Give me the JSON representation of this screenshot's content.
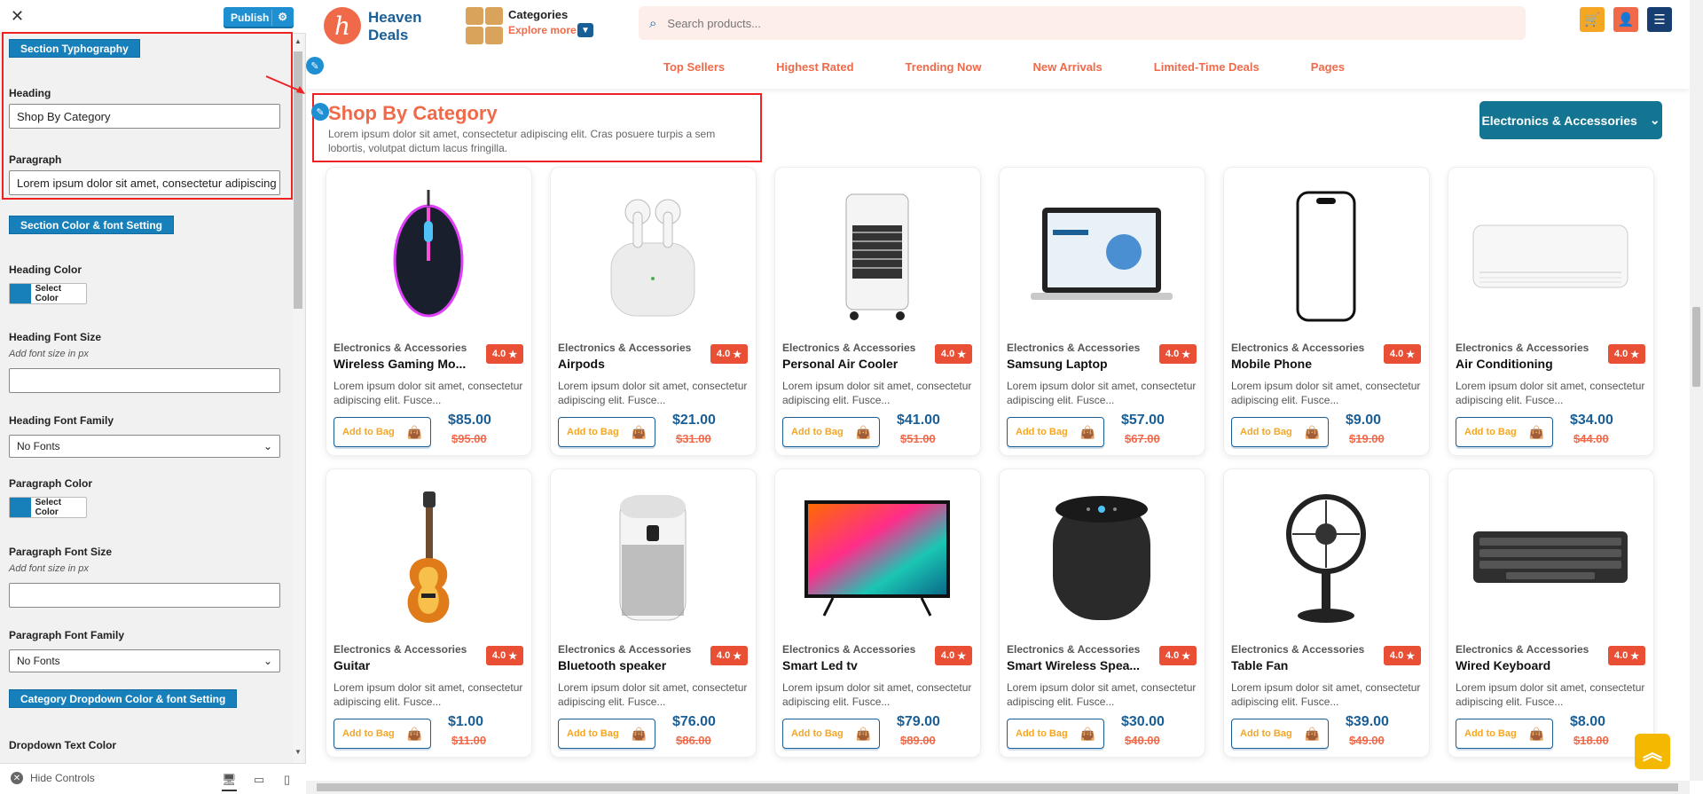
{
  "customizer": {
    "close": "✕",
    "publish": "Publish",
    "section_typography": "Section Typhography",
    "heading_label": "Heading",
    "heading_value": "Shop By Category",
    "paragraph_label": "Paragraph",
    "paragraph_value": "Lorem ipsum dolor sit amet, consectetur adipiscing elit. Cras posuere turpis a sem",
    "section_color_font": "Section Color & font Setting",
    "heading_color": "Heading Color",
    "select_color": "Select Color",
    "heading_font_size": "Heading Font Size",
    "add_font_size": "Add font size in px",
    "heading_font_family": "Heading Font Family",
    "no_fonts": "No Fonts",
    "paragraph_color": "Paragraph Color",
    "paragraph_font_size": "Paragraph Font Size",
    "paragraph_font_family": "Paragraph Font Family",
    "category_dropdown": "Category Dropdown Color & font Setting",
    "dropdown_text_color": "Dropdown Text Color",
    "hide_controls": "Hide Controls",
    "accent_color": "#1780bb"
  },
  "header": {
    "logo_letter": "h",
    "logo_text": "Heaven Deals",
    "categories": "Categories",
    "explore_more": "Explore more",
    "search_placeholder": "Search products...",
    "nav": [
      "Top Sellers",
      "Highest Rated",
      "Trending Now",
      "New Arrivals",
      "Limited-Time Deals",
      "Pages"
    ]
  },
  "section": {
    "title": "Shop By Category",
    "paragraph": "Lorem ipsum dolor sit amet, consectetur adipiscing elit. Cras posuere turpis a sem lobortis, volutpat dictum lacus fringilla.",
    "dropdown": "Electronics & Accessories"
  },
  "products": [
    {
      "category": "Electronics & Accessories",
      "name": "Wireless Gaming Mo...",
      "rating": "4.0",
      "desc": "Lorem ipsum dolor sit amet, consectetur adipiscing elit. Fusce...",
      "bag": "Add to Bag",
      "price": "$85.00",
      "old": "$95.00",
      "icon": "mouse"
    },
    {
      "category": "Electronics & Accessories",
      "name": "Airpods",
      "rating": "4.0",
      "desc": "Lorem ipsum dolor sit amet, consectetur adipiscing elit. Fusce...",
      "bag": "Add to Bag",
      "price": "$21.00",
      "old": "$31.00",
      "icon": "airpods"
    },
    {
      "category": "Electronics & Accessories",
      "name": "Personal Air Cooler",
      "rating": "4.0",
      "desc": "Lorem ipsum dolor sit amet, consectetur adipiscing elit. Fusce...",
      "bag": "Add to Bag",
      "price": "$41.00",
      "old": "$51.00",
      "icon": "cooler"
    },
    {
      "category": "Electronics & Accessories",
      "name": "Samsung Laptop",
      "rating": "4.0",
      "desc": "Lorem ipsum dolor sit amet, consectetur adipiscing elit. Fusce...",
      "bag": "Add to Bag",
      "price": "$57.00",
      "old": "$67.00",
      "icon": "laptop"
    },
    {
      "category": "Electronics & Accessories",
      "name": "Mobile Phone",
      "rating": "4.0",
      "desc": "Lorem ipsum dolor sit amet, consectetur adipiscing elit. Fusce...",
      "bag": "Add to Bag",
      "price": "$9.00",
      "old": "$19.00",
      "icon": "phone"
    },
    {
      "category": "Electronics & Accessories",
      "name": "Air Conditioning",
      "rating": "4.0",
      "desc": "Lorem ipsum dolor sit amet, consectetur adipiscing elit. Fusce...",
      "bag": "Add to Bag",
      "price": "$34.00",
      "old": "$44.00",
      "icon": "ac"
    },
    {
      "category": "Electronics & Accessories",
      "name": "Guitar",
      "rating": "4.0",
      "desc": "Lorem ipsum dolor sit amet, consectetur adipiscing elit. Fusce...",
      "bag": "Add to Bag",
      "price": "$1.00",
      "old": "$11.00",
      "icon": "guitar"
    },
    {
      "category": "Electronics & Accessories",
      "name": "Bluetooth speaker",
      "rating": "4.0",
      "desc": "Lorem ipsum dolor sit amet, consectetur adipiscing elit. Fusce...",
      "bag": "Add to Bag",
      "price": "$76.00",
      "old": "$86.00",
      "icon": "purifier"
    },
    {
      "category": "Electronics & Accessories",
      "name": "Smart Led tv",
      "rating": "4.0",
      "desc": "Lorem ipsum dolor sit amet, consectetur adipiscing elit. Fusce...",
      "bag": "Add to Bag",
      "price": "$79.00",
      "old": "$89.00",
      "icon": "tv"
    },
    {
      "category": "Electronics & Accessories",
      "name": "Smart Wireless Spea...",
      "rating": "4.0",
      "desc": "Lorem ipsum dolor sit amet, consectetur adipiscing elit. Fusce...",
      "bag": "Add to Bag",
      "price": "$30.00",
      "old": "$40.00",
      "icon": "speaker"
    },
    {
      "category": "Electronics & Accessories",
      "name": "Table Fan",
      "rating": "4.0",
      "desc": "Lorem ipsum dolor sit amet, consectetur adipiscing elit. Fusce...",
      "bag": "Add to Bag",
      "price": "$39.00",
      "old": "$49.00",
      "icon": "fan"
    },
    {
      "category": "Electronics & Accessories",
      "name": "Wired Keyboard",
      "rating": "4.0",
      "desc": "Lorem ipsum dolor sit amet, consectetur adipiscing elit. Fusce...",
      "bag": "Add to Bag",
      "price": "$8.00",
      "old": "$18.00",
      "icon": "keyboard"
    }
  ]
}
